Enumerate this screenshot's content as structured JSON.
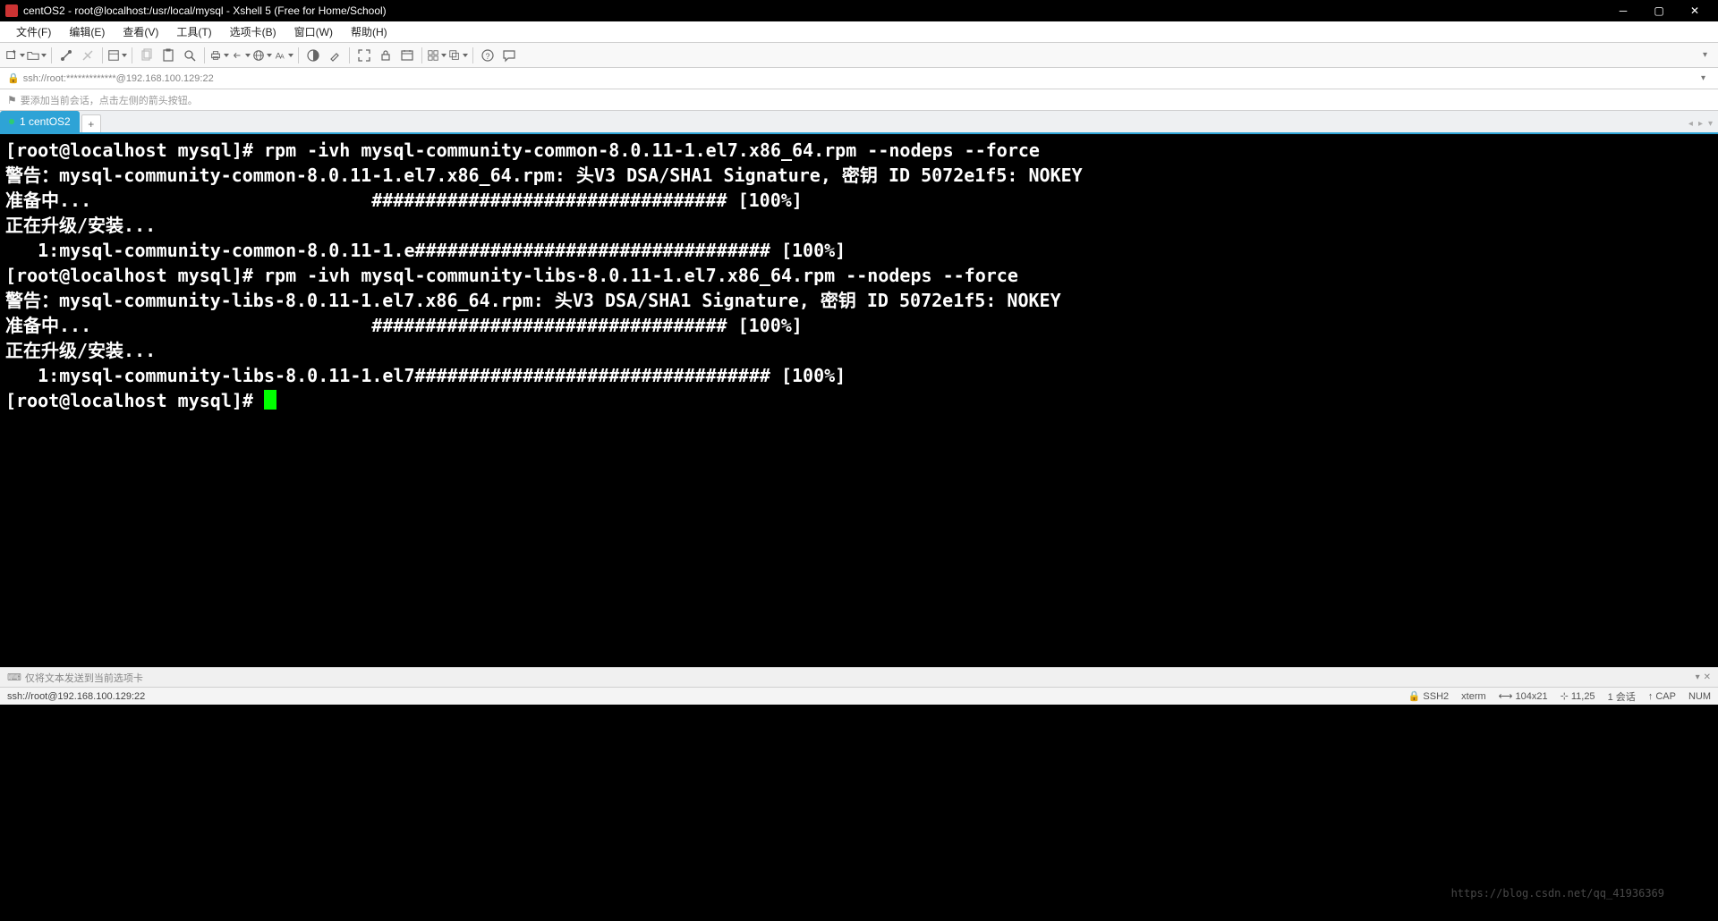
{
  "window": {
    "title": "centOS2 - root@localhost:/usr/local/mysql - Xshell 5 (Free for Home/School)"
  },
  "menu": {
    "items": [
      "文件(F)",
      "编辑(E)",
      "查看(V)",
      "工具(T)",
      "选项卡(B)",
      "窗口(W)",
      "帮助(H)"
    ]
  },
  "address": {
    "text": "ssh://root:*************@192.168.100.129:22"
  },
  "hint": {
    "text": "要添加当前会话，点击左侧的箭头按钮。"
  },
  "tabs": {
    "items": [
      {
        "label": "1 centOS2",
        "active": true
      }
    ],
    "add": "+"
  },
  "terminal": {
    "lines": [
      "[root@localhost mysql]# rpm -ivh mysql-community-common-8.0.11-1.el7.x86_64.rpm --nodeps --force",
      "警告：mysql-community-common-8.0.11-1.el7.x86_64.rpm: 头V3 DSA/SHA1 Signature, 密钥 ID 5072e1f5: NOKEY",
      "准备中...                          ################################# [100%]",
      "正在升级/安装...",
      "   1:mysql-community-common-8.0.11-1.e################################# [100%]",
      "[root@localhost mysql]# rpm -ivh mysql-community-libs-8.0.11-1.el7.x86_64.rpm --nodeps --force",
      "警告：mysql-community-libs-8.0.11-1.el7.x86_64.rpm: 头V3 DSA/SHA1 Signature, 密钥 ID 5072e1f5: NOKEY",
      "准备中...                          ################################# [100%]",
      "正在升级/安装...",
      "   1:mysql-community-libs-8.0.11-1.el7################################# [100%]",
      "[root@localhost mysql]# "
    ]
  },
  "status_send": {
    "text": "仅将文本发送到当前选项卡"
  },
  "status": {
    "left": "ssh://root@192.168.100.129:22",
    "ssh": "SSH2",
    "term": "xterm",
    "size": "104x21",
    "pos": "11,25",
    "session": "1 会话",
    "cap": "CAP",
    "num": "NUM"
  },
  "watermark": "https://blog.csdn.net/qq_41936369"
}
